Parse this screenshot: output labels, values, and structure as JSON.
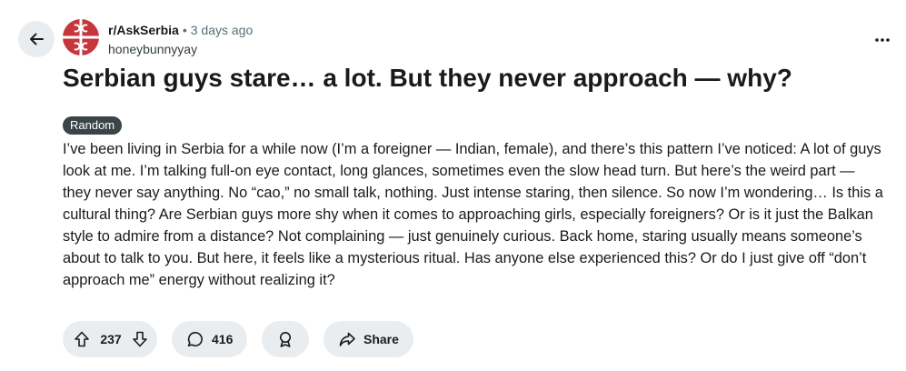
{
  "post": {
    "subreddit": "r/AskSerbia",
    "separator": "•",
    "time_ago": "3 days ago",
    "author": "honeybunnyyay",
    "title": "Serbian guys stare… a lot. But they never approach — why?",
    "flair": "Random",
    "body": "I’ve been living in Serbia for a while now (I’m a foreigner — Indian, female), and there’s this pattern I’ve noticed: A lot of guys look at me. I’m talking full-on eye contact, long glances, sometimes even the slow head turn. But here’s the weird part — they never say anything. No “cao,” no small talk, nothing. Just intense staring, then silence. So now I’m wondering… Is this a cultural thing? Are Serbian guys more shy when it comes to approaching girls, especially foreigners? Or is it just the Balkan style to admire from a distance? Not complaining — just genuinely curious. Back home, staring usually means someone’s about to talk to you. But here, it feels like a mysterious ritual. Has anyone else experienced this? Or do I just give off “don’t approach me” energy without realizing it?"
  },
  "actions": {
    "upvotes": "237",
    "comments": "416",
    "share_label": "Share"
  },
  "icons": {
    "back": "arrow-left-icon",
    "more": "ellipsis-icon",
    "upvote": "arrow-up-icon",
    "downvote": "arrow-down-icon",
    "comment": "speech-bubble-icon",
    "award": "award-ribbon-icon",
    "share": "share-arrow-icon"
  },
  "colors": {
    "pill_background": "#eaedef",
    "flair_background": "#3c4447",
    "avatar_red": "#c6363c",
    "text": "#1a1a1b",
    "muted_text": "#576f76"
  }
}
